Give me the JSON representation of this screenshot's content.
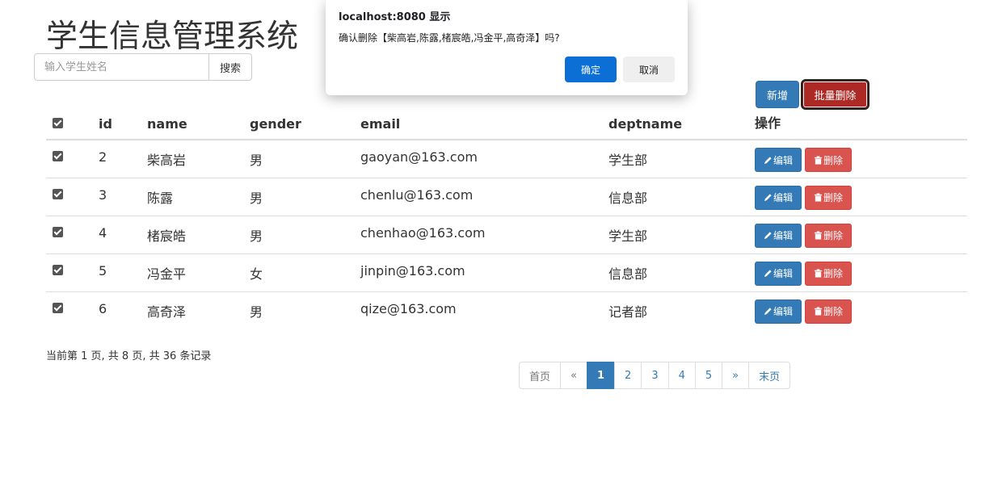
{
  "page_title": "学生信息管理系统",
  "search": {
    "placeholder": "输入学生姓名",
    "button_label": "搜索"
  },
  "toolbar": {
    "add_label": "新增",
    "batch_delete_label": "批量删除"
  },
  "table": {
    "headers": [
      "id",
      "name",
      "gender",
      "email",
      "deptname",
      "操作"
    ],
    "rows": [
      {
        "id": "2",
        "name": "柴高岩",
        "gender": "男",
        "email": "gaoyan@163.com",
        "deptname": "学生部"
      },
      {
        "id": "3",
        "name": "陈露",
        "gender": "男",
        "email": "chenlu@163.com",
        "deptname": "信息部"
      },
      {
        "id": "4",
        "name": "楮宸皓",
        "gender": "男",
        "email": "chenhao@163.com",
        "deptname": "学生部"
      },
      {
        "id": "5",
        "name": "冯金平",
        "gender": "女",
        "email": "jinpin@163.com",
        "deptname": "信息部"
      },
      {
        "id": "6",
        "name": "高奇泽",
        "gender": "男",
        "email": "qize@163.com",
        "deptname": "记者部"
      }
    ],
    "edit_label": "编辑",
    "delete_label": "删除"
  },
  "page_info": "当前第 1 页, 共 8 页, 共 36 条记录",
  "pagination": {
    "first": "首页",
    "prev": "«",
    "pages": [
      "1",
      "2",
      "3",
      "4",
      "5"
    ],
    "next": "»",
    "last": "末页",
    "active": "1"
  },
  "dialog": {
    "title": "localhost:8080 显示",
    "message": "确认删除【柴高岩,陈露,楮宸皓,冯金平,高奇泽】吗?",
    "ok_label": "确定",
    "cancel_label": "取消"
  },
  "colors": {
    "primary": "#337ab7",
    "danger": "#d9534f",
    "dialog_ok": "#0b6fd6"
  },
  "icons": {
    "edit": "pencil-icon",
    "delete": "trash-icon"
  }
}
